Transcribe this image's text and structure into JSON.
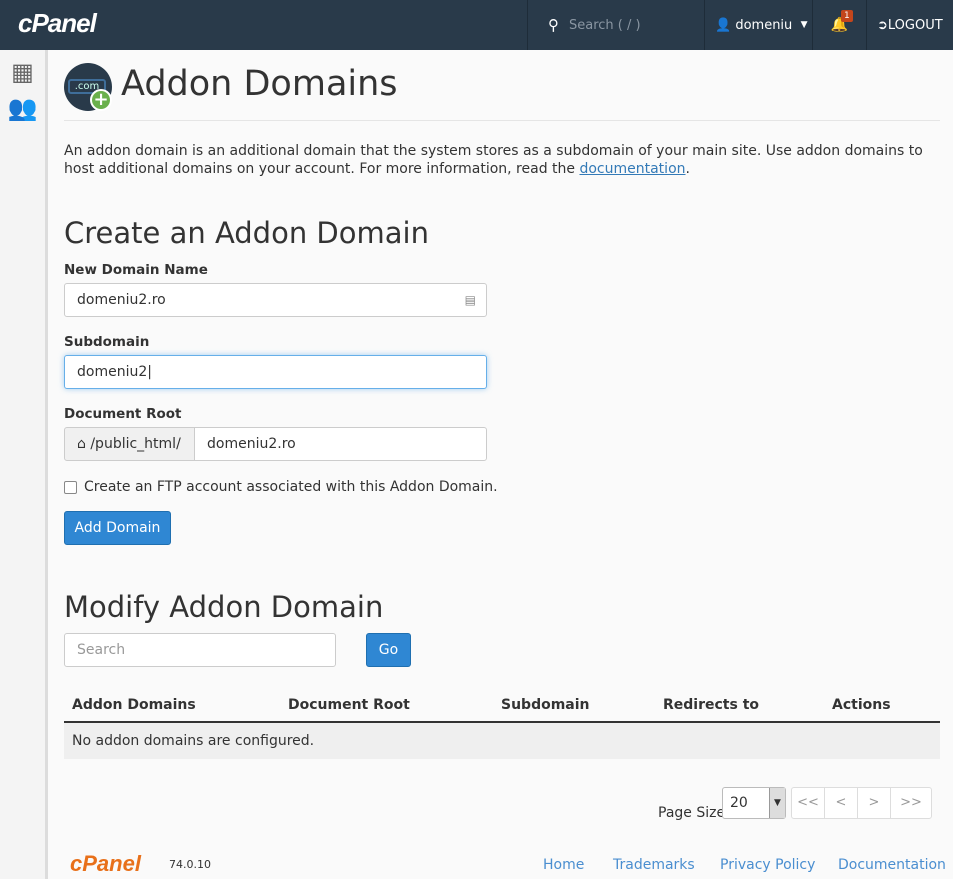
{
  "header": {
    "logo": "cPanel",
    "search_placeholder": "Search ( / )",
    "user": "domeniu",
    "notifications": "1",
    "logout": "LOGOUT"
  },
  "sidebar": {
    "items": [
      {
        "icon": "grid-icon"
      },
      {
        "icon": "users-icon"
      }
    ]
  },
  "page": {
    "title": "Addon Domains",
    "icon_text": ".com",
    "description": "An addon domain is an additional domain that the system stores as a subdomain of your main site. Use addon domains to host additional domains on your account. For more information, read the ",
    "doc_link": "documentation",
    "period": "."
  },
  "create": {
    "heading": "Create an Addon Domain",
    "new_domain_label": "New Domain Name",
    "new_domain_value": "domeniu2.ro",
    "subdomain_label": "Subdomain",
    "subdomain_value": "domeniu2",
    "docroot_label": "Document Root",
    "docroot_prefix": "/public_html/",
    "docroot_value": "domeniu2.ro",
    "ftp_label": "Create an FTP account associated with this Addon Domain.",
    "ftp_checked": false,
    "submit": "Add Domain"
  },
  "modify": {
    "heading": "Modify Addon Domain",
    "search_placeholder": "Search",
    "go": "Go",
    "columns": [
      "Addon Domains",
      "Document Root",
      "Subdomain",
      "Redirects to",
      "Actions"
    ],
    "empty": "No addon domains are configured.",
    "page_size_label": "Page Size",
    "page_size": "20",
    "pager": [
      "<<",
      "<",
      ">",
      ">>"
    ]
  },
  "footer": {
    "logo": "cPanel",
    "version": "74.0.10",
    "links": [
      "Home",
      "Trademarks",
      "Privacy Policy",
      "Documentation"
    ]
  }
}
